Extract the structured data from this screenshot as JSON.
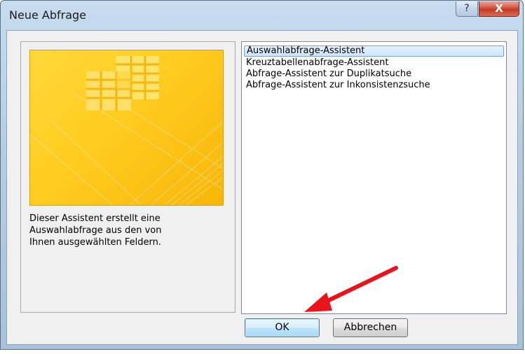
{
  "window": {
    "title": "Neue Abfrage",
    "help_glyph": "?",
    "close_glyph": "X"
  },
  "left_panel": {
    "description_lines": [
      "Dieser Assistent erstellt eine",
      "Auswahlabfrage aus den von",
      "Ihnen ausgewählten Feldern."
    ]
  },
  "list": {
    "items": [
      {
        "label": "Auswahlabfrage-Assistent",
        "selected": true
      },
      {
        "label": "Kreuztabellenabfrage-Assistent",
        "selected": false
      },
      {
        "label": "Abfrage-Assistent zur Duplikatsuche",
        "selected": false
      },
      {
        "label": "Abfrage-Assistent zur Inkonsistenzsuche",
        "selected": false
      }
    ]
  },
  "buttons": {
    "ok": "OK",
    "cancel": "Abbrechen"
  },
  "colors": {
    "accent_arrow": "#e8131b",
    "preview_yellow": "#ffcc1f",
    "selection_border": "#7da2ce"
  },
  "icons": {
    "preview": "table-grid-illustration",
    "annotation": "red-arrow"
  }
}
